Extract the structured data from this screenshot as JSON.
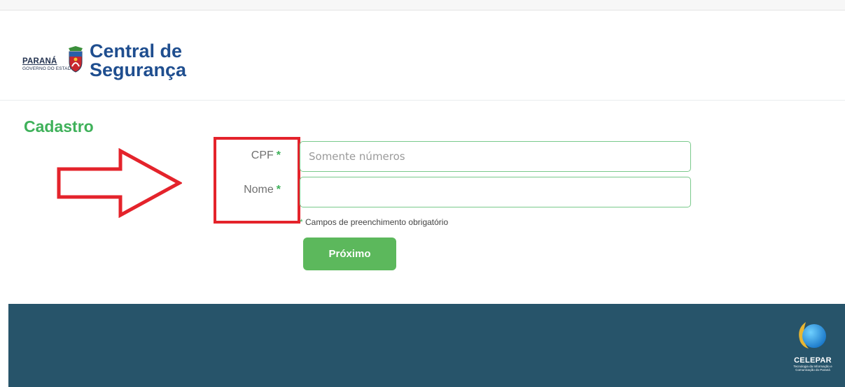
{
  "header": {
    "gov_name": "PARANÁ",
    "gov_sub": "GOVERNO DO ESTADO",
    "title_line1": "Central de",
    "title_line2": "Segurança"
  },
  "page": {
    "title": "Cadastro"
  },
  "form": {
    "cpf_label": "CPF",
    "cpf_placeholder": "Somente números",
    "cpf_value": "",
    "nome_label": "Nome",
    "nome_value": "",
    "required_mark": "*",
    "required_note": "Campos de preenchimento obrigatório",
    "next_label": "Próximo"
  },
  "footer": {
    "logo_name": "CELEPAR",
    "logo_sub": "Tecnologia da Informação e Comunicação do Paraná"
  },
  "colors": {
    "brand_blue": "#1f4e8f",
    "accent_green": "#3fb15a",
    "button_green": "#5cb85c",
    "footer_bg": "#27546a",
    "annotation_red": "#e4232b"
  }
}
